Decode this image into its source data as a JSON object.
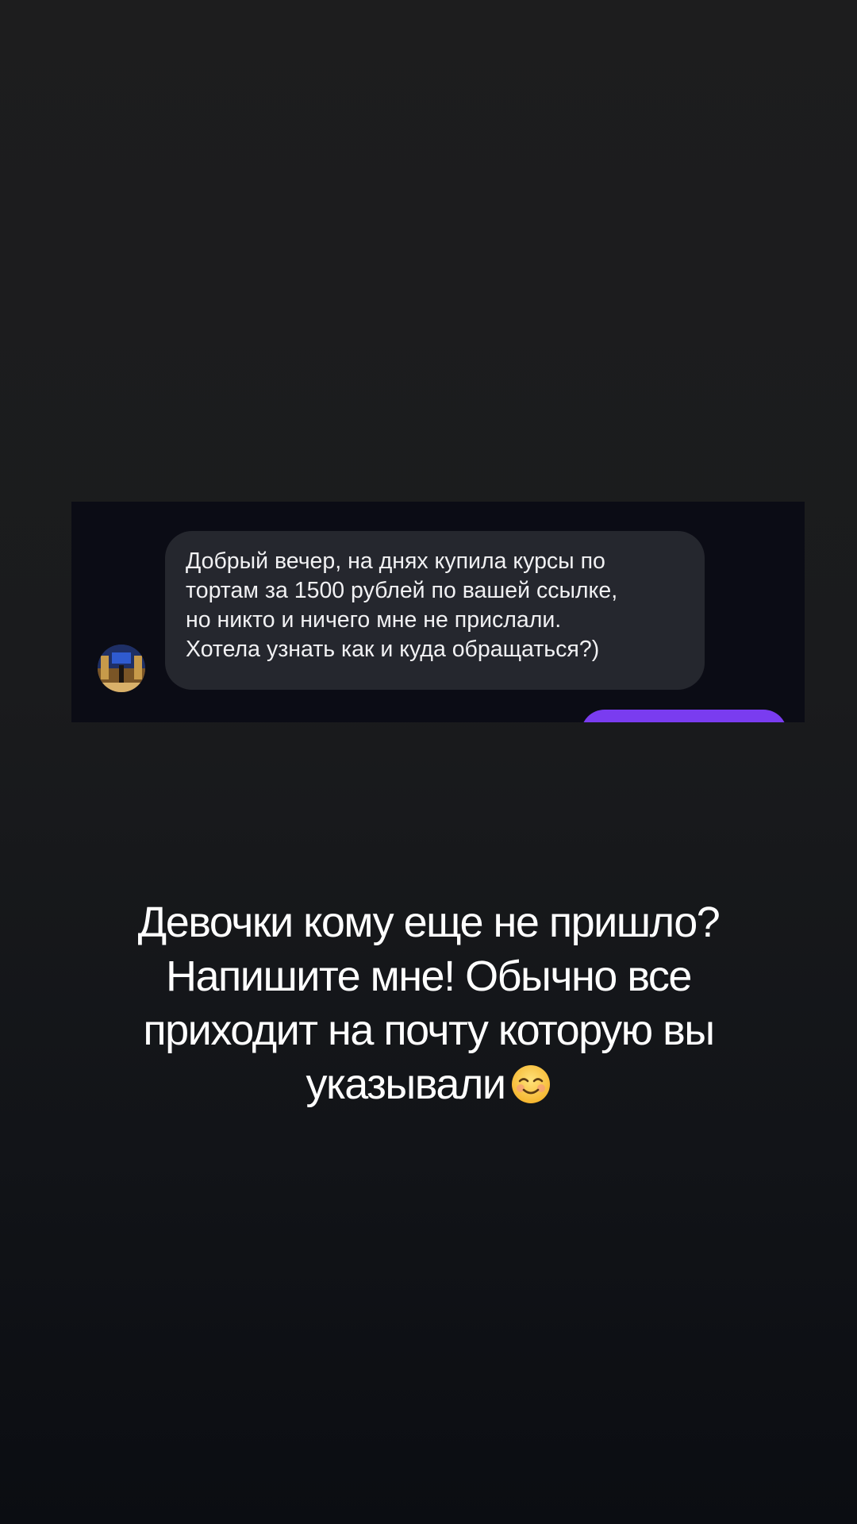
{
  "message": {
    "lines": [
      "Добрый вечер, на днях купила курсы по",
      "тортам за 1500 рублей по вашей ссылке,",
      "но никто и ничего мне не прислали.",
      "Хотела узнать как и куда обращаться?)"
    ],
    "sender_avatar": "avatar-photo",
    "bubble_color": "#25272e",
    "sent_bubble_color": "#7a3cf0"
  },
  "caption": {
    "lines": [
      "Девочки кому еще не пришло?",
      "Напишите мне! Обычно все",
      "приходит на почту которую вы",
      "указывали"
    ],
    "emoji": "smiling-face-icon"
  },
  "colors": {
    "background_top": "#1d1d1e",
    "background_bottom": "#0b0d12",
    "card_background": "#0b0c15",
    "text": "#ffffff"
  }
}
